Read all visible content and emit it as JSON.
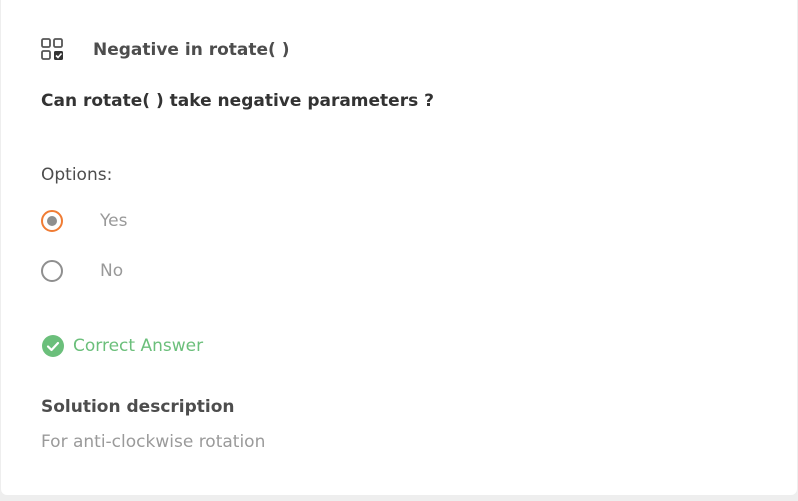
{
  "quiz": {
    "icon": "quiz-grid-check-icon",
    "title": "Negative in rotate( )"
  },
  "question": {
    "text": "Can rotate( ) take negative parameters ?"
  },
  "options": {
    "label": "Options:",
    "items": [
      {
        "label": "Yes",
        "selected": true
      },
      {
        "label": "No",
        "selected": false
      }
    ]
  },
  "result": {
    "icon": "check-circle-icon",
    "label": "Correct Answer"
  },
  "solution": {
    "heading": "Solution description",
    "text": "For anti-clockwise rotation"
  },
  "colors": {
    "selected_ring": "#f07c34",
    "correct": "#6bbf7b",
    "text_dark": "#4d4d4d",
    "text_muted": "#999999"
  }
}
